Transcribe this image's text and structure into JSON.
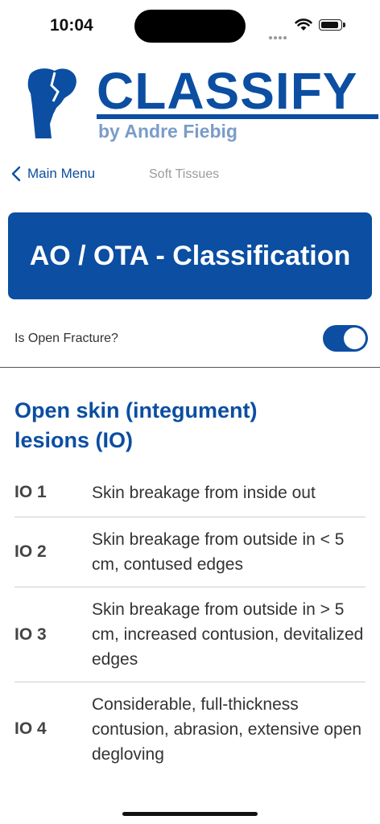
{
  "status_bar": {
    "time": "10:04"
  },
  "logo": {
    "word": "CLASSIFY",
    "subtitle": "by Andre Fiebig"
  },
  "nav": {
    "back_label": "Main Menu",
    "title": "Soft Tissues"
  },
  "banner": {
    "title": "AO / OTA - Classification"
  },
  "toggle": {
    "label": "Is Open Fracture?",
    "on": true
  },
  "section": {
    "title": "Open skin (integument) lesions (IO)"
  },
  "rows": [
    {
      "code": "IO 1",
      "description": "Skin breakage from inside out"
    },
    {
      "code": "IO 2",
      "description": "Skin breakage from outside in < 5 cm, contused edges"
    },
    {
      "code": "IO 3",
      "description": "Skin breakage from outside in > 5 cm, increased contusion, devitalized edges"
    },
    {
      "code": "IO 4",
      "description": "Considerable, full-thickness contusion, abrasion, extensive open degloving"
    }
  ],
  "colors": {
    "brand": "#0b4ea2",
    "subtitle": "#7a9cc8",
    "muted": "#9b9b9b"
  }
}
